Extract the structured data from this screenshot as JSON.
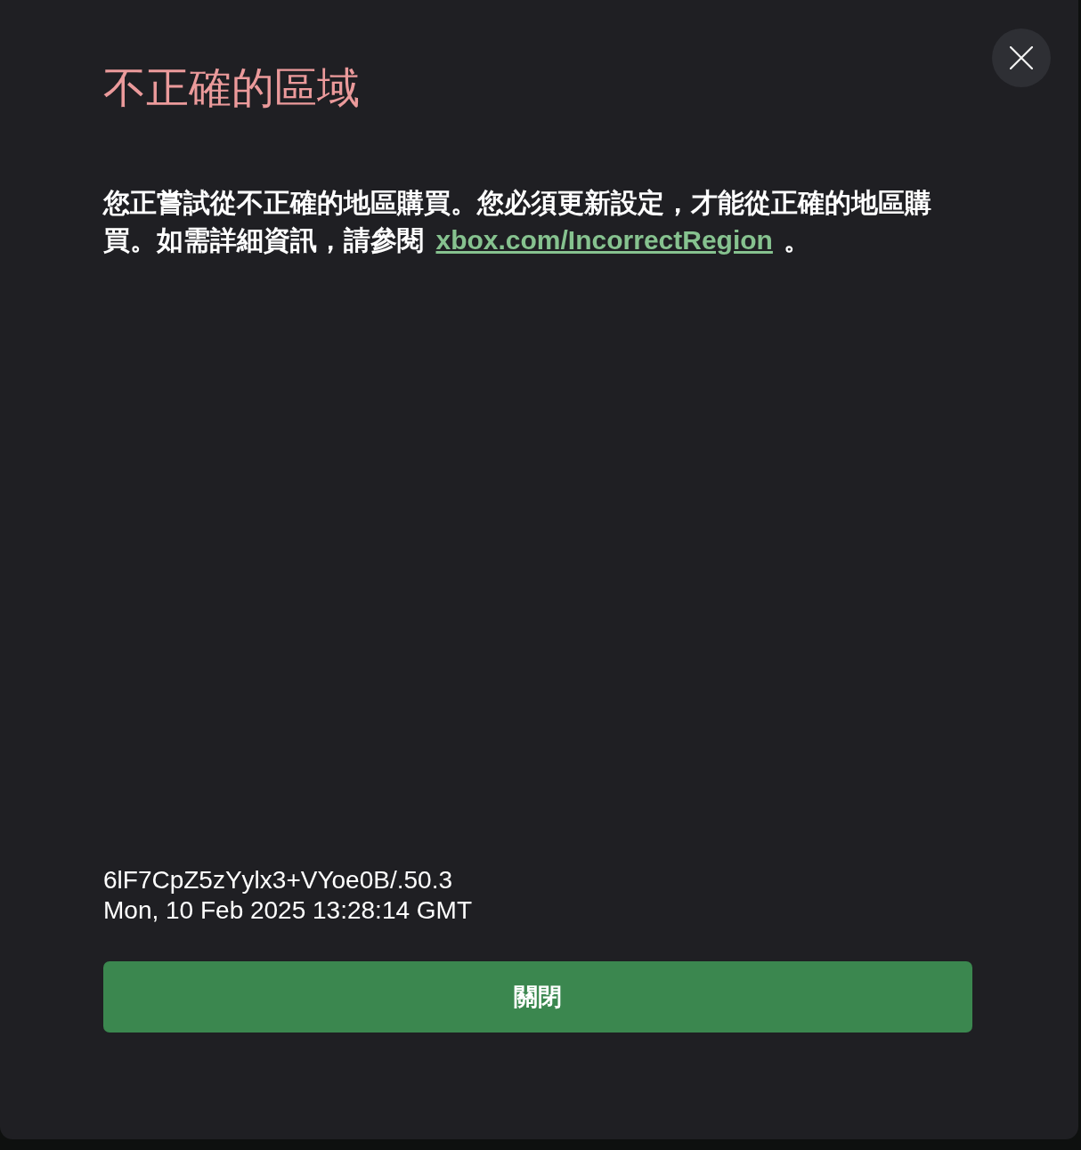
{
  "dialog": {
    "title": "不正確的區域"
  },
  "message": {
    "text": "您正嘗試從不正確的地區購買。您必須更新設定，才能從正確的地區購買。如需詳細資訊，請參閱",
    "link": "xbox.com/IncorrectRegion",
    "text_after": "。"
  },
  "diagnostics": [
    "6lF7CpZ5zYylx3+VYoe0B/.50.3",
    "Mon, 10 Feb 2025 13:28:14 GMT"
  ],
  "buttons": [
    {
      "label": "關閉"
    }
  ]
}
